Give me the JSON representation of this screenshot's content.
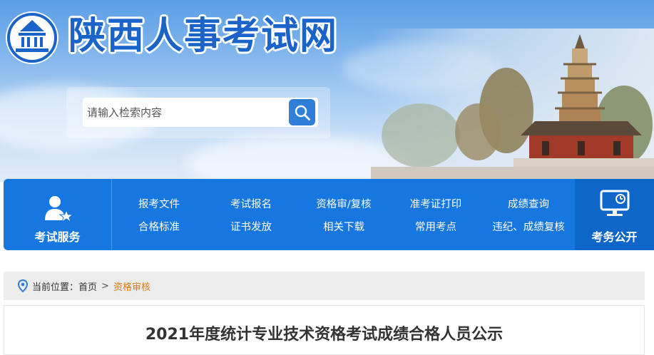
{
  "header": {
    "site_title": "陕西人事考试网",
    "logo_icon": "pagoda-logo-icon"
  },
  "search": {
    "placeholder": "请输入检索内容",
    "button_icon": "search-icon",
    "button_color": "#2f7fd8"
  },
  "nav": {
    "background_color": "#1677e0",
    "service": {
      "label": "考试服务",
      "icon": "user-service-icon"
    },
    "menu_row1": [
      "报考文件",
      "考试报名",
      "资格审/复核",
      "准考证打印",
      "成绩查询"
    ],
    "menu_row2": [
      "合格标准",
      "证书发放",
      "相关下载",
      "常用考点",
      "违纪、成绩复核"
    ],
    "public": {
      "label": "考务公开",
      "icon": "monitor-icon"
    }
  },
  "breadcrumb": {
    "prefix": "当前位置：",
    "home": "首页",
    "separator": ">",
    "current": "资格审核",
    "current_color": "#e07a14",
    "icon": "location-pin-icon"
  },
  "article": {
    "title": "2021年度统计专业技术资格考试成绩合格人员公示"
  }
}
